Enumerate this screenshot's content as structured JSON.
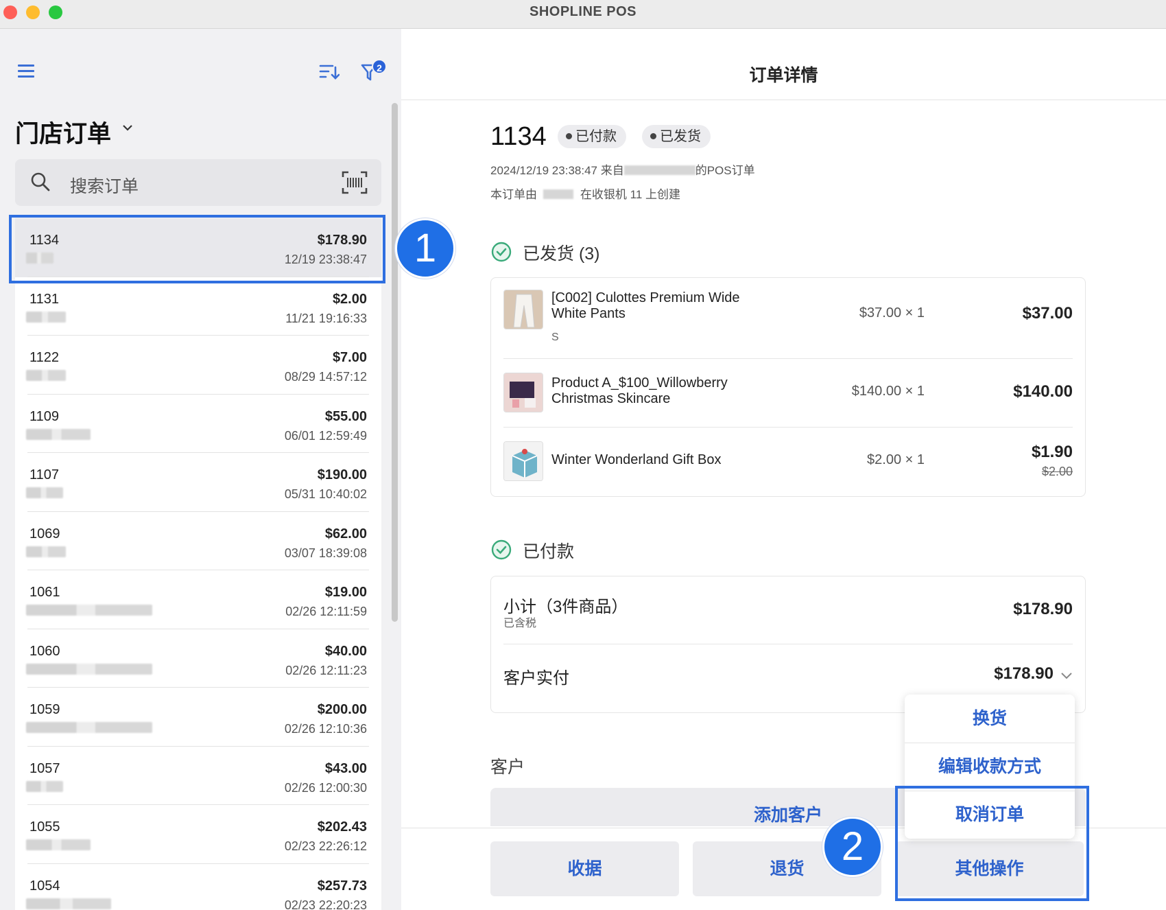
{
  "app": {
    "title": "SHOPLINE POS"
  },
  "left": {
    "store_title": "门店订单",
    "search_placeholder": "搜索订单",
    "filter_count": "2",
    "orders": [
      {
        "number": "1134",
        "amount": "$178.90",
        "datetime": "12/19 23:38:47"
      },
      {
        "number": "1131",
        "amount": "$2.00",
        "datetime": "11/21 19:16:33"
      },
      {
        "number": "1122",
        "amount": "$7.00",
        "datetime": "08/29 14:57:12"
      },
      {
        "number": "1109",
        "amount": "$55.00",
        "datetime": "06/01 12:59:49"
      },
      {
        "number": "1107",
        "amount": "$190.00",
        "datetime": "05/31 10:40:02"
      },
      {
        "number": "1069",
        "amount": "$62.00",
        "datetime": "03/07 18:39:08"
      },
      {
        "number": "1061",
        "amount": "$19.00",
        "datetime": "02/26 12:11:59"
      },
      {
        "number": "1060",
        "amount": "$40.00",
        "datetime": "02/26 12:11:23"
      },
      {
        "number": "1059",
        "amount": "$200.00",
        "datetime": "02/26 12:10:36"
      },
      {
        "number": "1057",
        "amount": "$43.00",
        "datetime": "02/26 12:00:30"
      },
      {
        "number": "1055",
        "amount": "$202.43",
        "datetime": "02/23 22:26:12"
      },
      {
        "number": "1054",
        "amount": "$257.73",
        "datetime": "02/23 22:20:23"
      }
    ]
  },
  "detail": {
    "header_title": "订单详情",
    "order_number": "1134",
    "status_paid": "已付款",
    "status_shipped": "已发货",
    "meta_line1_prefix": "2024/12/19 23:38:47 来自",
    "meta_line1_suffix": "的POS订单",
    "meta_line2_prefix": "本订单由",
    "meta_line2_suffix": "在收银机  11  上创建",
    "shipped_section": "已发货 (3)",
    "items": [
      {
        "name": "[C002] Culottes Premium Wide White Pants",
        "variant": "S",
        "qty": "$37.00 × 1",
        "total": "$37.00",
        "original": ""
      },
      {
        "name": "Product A_$100_Willowberry Christmas Skincare",
        "variant": "",
        "qty": "$140.00 × 1",
        "total": "$140.00",
        "original": ""
      },
      {
        "name": "Winter Wonderland Gift Box",
        "variant": "",
        "qty": "$2.00 × 1",
        "total": "$1.90",
        "original": "$2.00"
      }
    ],
    "paid_section": "已付款",
    "subtotal_label": "小计（3件商品）",
    "subtotal_sub": "已含税",
    "subtotal_value": "$178.90",
    "customer_paid_label": "客户实付",
    "customer_paid_value": "$178.90",
    "customer_section": "客户",
    "add_customer": "添加客户"
  },
  "footer": {
    "receipt": "收据",
    "return": "退货",
    "more_actions": "其他操作"
  },
  "menu": {
    "exchange": "换货",
    "edit_payment": "编辑收款方式",
    "cancel_order": "取消订单"
  },
  "annotations": {
    "step1": "1",
    "step2": "2"
  },
  "colors": {
    "accent": "#2e62cc",
    "highlight": "#2f6fe0",
    "badge": "#1f6fe6",
    "check": "#3aaa7a"
  }
}
